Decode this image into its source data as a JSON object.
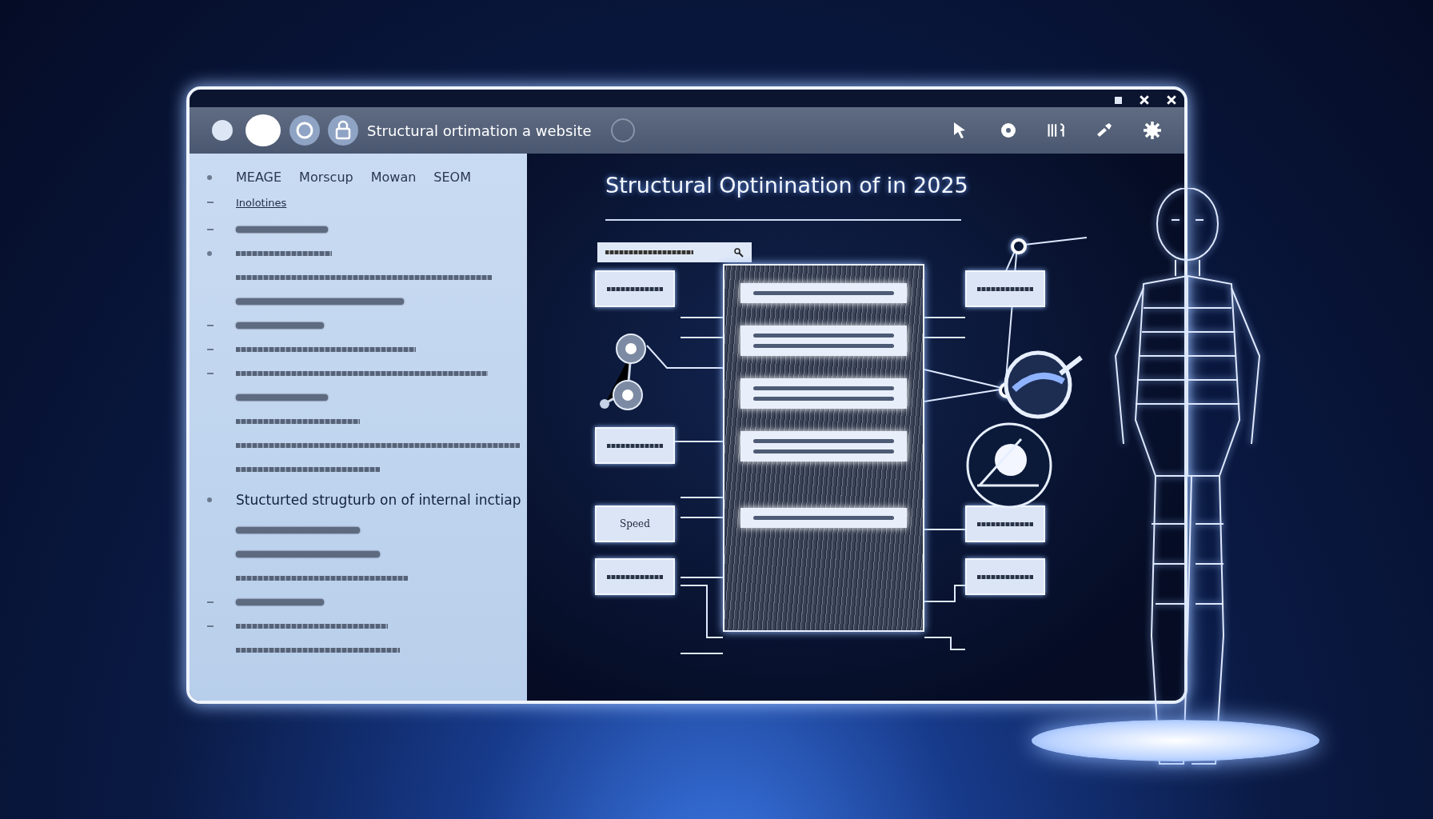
{
  "window": {
    "title": "Structural ortimation a website"
  },
  "sidebar": {
    "items": [
      {
        "kind": "nav",
        "marker": {
          "kind": "dot"
        },
        "labels": [
          "MEAGE",
          "Morscup",
          "Mowan",
          "SEOM"
        ]
      },
      {
        "kind": "link",
        "marker": {
          "kind": "dash"
        },
        "text": "Inolotines"
      },
      {
        "kind": "pill",
        "marker": {
          "kind": "dash"
        }
      },
      {
        "kind": "line",
        "marker": {
          "kind": "dot"
        }
      },
      {
        "kind": "line"
      },
      {
        "kind": "pill"
      },
      {
        "kind": "pill",
        "marker": {
          "kind": "dash"
        }
      },
      {
        "kind": "line",
        "marker": {
          "kind": "dash"
        }
      },
      {
        "kind": "line",
        "marker": {
          "kind": "dash"
        }
      },
      {
        "kind": "pill"
      },
      {
        "kind": "line"
      },
      {
        "kind": "line"
      },
      {
        "kind": "line"
      },
      {
        "kind": "heading",
        "marker": {
          "kind": "dot"
        },
        "text": "Stucturted strugturb on of internal inctiap"
      },
      {
        "kind": "pill"
      },
      {
        "kind": "pill"
      },
      {
        "kind": "line"
      },
      {
        "kind": "pill",
        "marker": {
          "kind": "dash"
        }
      },
      {
        "kind": "line",
        "marker": {
          "kind": "dash"
        }
      },
      {
        "kind": "line"
      }
    ]
  },
  "main": {
    "title": "Structural Optinination of in 2025",
    "diagram": {
      "left_boxes": [
        {
          "kind": "blurred"
        },
        {
          "kind": "blurred"
        },
        {
          "kind": "text",
          "label": "Speed"
        },
        {
          "kind": "blurred"
        }
      ],
      "right_boxes": [
        {
          "kind": "blurred"
        },
        {
          "kind": "blurred"
        },
        {
          "kind": "blurred"
        }
      ]
    }
  }
}
